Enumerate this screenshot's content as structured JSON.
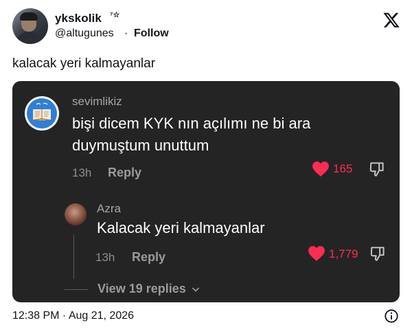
{
  "author": {
    "name": "ykskolik",
    "badge": "⁷☆",
    "handle": "@altugunes",
    "separator": "·",
    "follow_label": "Follow"
  },
  "tweet": {
    "text": "kalacak yeri kalmayanlar",
    "timestamp": "12:38 PM · Aug 21, 2026"
  },
  "embedded": {
    "comment": {
      "username": "sevimlikiz",
      "text": "bişi dicem KYK nın açılımı ne bi ara duymuştum unuttum",
      "time": "13h",
      "reply_label": "Reply",
      "likes": "165"
    },
    "reply": {
      "username": "Azra",
      "text": "Kalacak yeri kalmayanlar",
      "time": "13h",
      "reply_label": "Reply",
      "likes": "1,779"
    },
    "view_replies_label": "View 19 replies"
  },
  "colors": {
    "card_bg": "#242424",
    "like_red": "#fe2c55",
    "muted_text": "#9a9aa0"
  }
}
